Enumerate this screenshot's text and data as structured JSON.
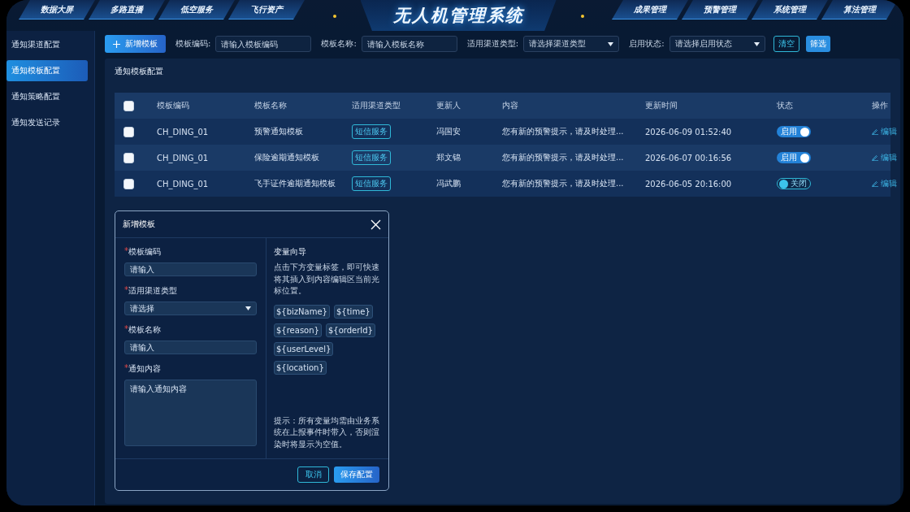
{
  "header": {
    "title": "无人机管理系统",
    "left_tabs": [
      {
        "label": "数据大屏"
      },
      {
        "label": "多路直播"
      },
      {
        "label": "低空服务"
      },
      {
        "label": "飞行资产"
      }
    ],
    "right_tabs": [
      {
        "label": "成果管理"
      },
      {
        "label": "预警管理"
      },
      {
        "label": "系统管理"
      },
      {
        "label": "算法管理"
      }
    ]
  },
  "sidebar": {
    "items": [
      {
        "label": "通知渠道配置",
        "selected": false
      },
      {
        "label": "通知模板配置",
        "selected": true
      },
      {
        "label": "通知策略配置",
        "selected": false
      },
      {
        "label": "通知发送记录",
        "selected": false
      }
    ]
  },
  "filters": {
    "add_button": "新增模板",
    "fields": [
      {
        "kind": "input",
        "label": "模板编码:",
        "placeholder": "请输入模板编码"
      },
      {
        "kind": "input",
        "label": "模板名称:",
        "placeholder": "请输入模板名称"
      },
      {
        "kind": "select",
        "label": "适用渠道类型:",
        "placeholder": "请选择渠道类型"
      },
      {
        "kind": "select",
        "label": "启用状态:",
        "placeholder": "请选择启用状态"
      }
    ],
    "clear_button": "清空",
    "filter_button": "筛选"
  },
  "panel": {
    "title": "通知模板配置"
  },
  "table": {
    "header_checked": false,
    "columns": [
      "模板编码",
      "模板名称",
      "适用渠道类型",
      "更新人",
      "内容",
      "更新时间",
      "状态",
      "操作"
    ],
    "rows": [
      {
        "checked": false,
        "code": "CH_DING_01",
        "name": "预警通知模板",
        "channel": "短信服务",
        "updater": "冯国安",
        "content": "您有新的预警提示，请及时处理...",
        "time": "2026-06-09 01:52:40",
        "status": {
          "on": true,
          "label": "启用"
        },
        "action": "编辑"
      },
      {
        "checked": false,
        "code": "CH_DING_01",
        "name": "保险逾期通知模板",
        "channel": "短信服务",
        "updater": "郑文锦",
        "content": "您有新的预警提示，请及时处理...",
        "time": "2026-06-07 00:16:56",
        "status": {
          "on": true,
          "label": "启用"
        },
        "action": "编辑"
      },
      {
        "checked": false,
        "code": "CH_DING_01",
        "name": "飞手证件逾期通知模板",
        "channel": "短信服务",
        "updater": "冯武鹏",
        "content": "您有新的预警提示，请及时处理...",
        "time": "2026-06-05 20:16:00",
        "status": {
          "on": false,
          "label": "关闭"
        },
        "action": "编辑"
      }
    ]
  },
  "dialog": {
    "title": "新增模板",
    "fields": [
      {
        "kind": "input",
        "mark": "*",
        "label": "模板编码",
        "placeholder": "请输入"
      },
      {
        "kind": "select",
        "mark": "*",
        "label": "适用渠道类型",
        "placeholder": "请选择"
      },
      {
        "kind": "input",
        "mark": "*",
        "label": "模板名称",
        "placeholder": "请输入"
      },
      {
        "kind": "textarea",
        "mark": "*",
        "label": "通知内容",
        "placeholder": "请输入通知内容"
      }
    ],
    "guide": {
      "title": "变量向导",
      "description": "点击下方变量标签，即可快速将其插入到内容编辑区当前光标位置。",
      "variables": [
        "${bizName}",
        "${time}",
        "${reason}",
        "${orderId}",
        "${userLevel}",
        "${location}"
      ],
      "note": "提示：所有变量均需由业务系统在上报事件时带入，否则渲染时将显示为空值。"
    },
    "cancel_button": "取消",
    "save_button": "保存配置"
  }
}
